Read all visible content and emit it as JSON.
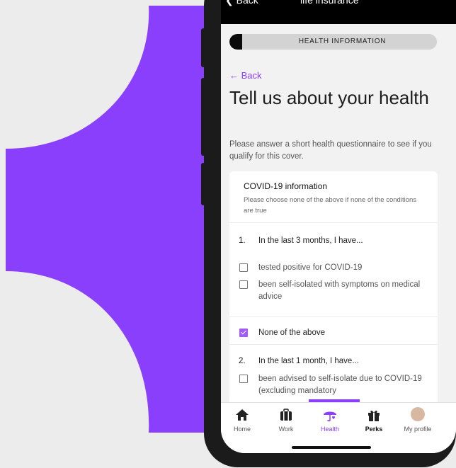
{
  "colors": {
    "accent": "#8a3ffc",
    "background_shape": "#8a3ffc"
  },
  "topbar": {
    "back_label": "Back",
    "title": "life insurance",
    "back_icon": "chevron-left-icon"
  },
  "progress": {
    "label": "HEALTH INFORMATION",
    "fraction": 0.06
  },
  "back_link": "← Back",
  "heading": "Tell us about your health",
  "subtext": "Please answer a short health questionnaire to see if you qualify for this cover.",
  "card": {
    "title": "COVID-19 information",
    "note": "Please choose none of the above if none of the conditions are true",
    "questions": [
      {
        "number": "1.",
        "text": "In the last 3 months, I have...",
        "options": [
          {
            "label": "tested positive for COVID-19",
            "checked": false
          },
          {
            "label": "been self-isolated with symptoms on medical advice",
            "checked": false
          }
        ]
      },
      {
        "none_label": "None of the above",
        "none_checked": true
      },
      {
        "number": "2.",
        "text": "In the last 1 month, I have...",
        "options": [
          {
            "label": "been advised to self-isolate due to COVID-19 (excluding mandatory",
            "checked": false
          }
        ]
      }
    ]
  },
  "tabs": [
    {
      "label": "Home",
      "icon": "home-icon"
    },
    {
      "label": "Work",
      "icon": "briefcase-icon"
    },
    {
      "label": "Health",
      "icon": "umbrella-heart-icon",
      "active": true
    },
    {
      "label": "Perks",
      "icon": "gift-icon"
    },
    {
      "label": "My profile",
      "icon": "avatar"
    }
  ]
}
